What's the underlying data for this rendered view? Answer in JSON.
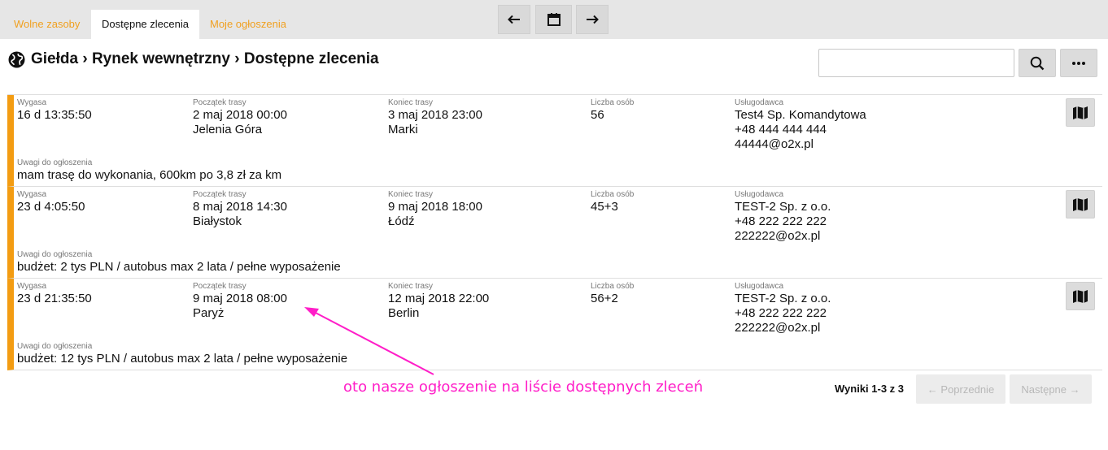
{
  "tabs": [
    {
      "label": "Wolne zasoby",
      "active": false
    },
    {
      "label": "Dostępne zlecenia",
      "active": true
    },
    {
      "label": "Moje ogłoszenia",
      "active": false
    }
  ],
  "nav": {
    "prev_icon": "arrow-left-icon",
    "calendar_icon": "calendar-icon",
    "next_icon": "arrow-right-icon"
  },
  "breadcrumb": {
    "icon": "globe-icon",
    "text": "Giełda › Rynek wewnętrzny › Dostępne zlecenia"
  },
  "search": {
    "value": "",
    "placeholder": "",
    "button_icon": "search-icon",
    "more_icon": "more-icon"
  },
  "labels": {
    "expires": "Wygasa",
    "route_start": "Początek trasy",
    "route_end": "Koniec trasy",
    "persons": "Liczba osób",
    "provider": "Usługodawca",
    "notes": "Uwagi do ogłoszenia"
  },
  "listings": [
    {
      "expires": "16 d 13:35:50",
      "start_date": "2 maj 2018 00:00",
      "start_city": "Jelenia Góra",
      "end_date": "3 maj 2018 23:00",
      "end_city": "Marki",
      "persons": "56",
      "provider_name": "Test4 Sp. Komandytowa",
      "provider_phone": "+48 444 444 444",
      "provider_email": "44444@o2x.pl",
      "notes": "mam trasę do wykonania, 600km po 3,8 zł za km"
    },
    {
      "expires": "23 d 4:05:50",
      "start_date": "8 maj 2018 14:30",
      "start_city": "Białystok",
      "end_date": "9 maj 2018 18:00",
      "end_city": "Łódź",
      "persons": "45+3",
      "provider_name": "TEST-2 Sp. z o.o.",
      "provider_phone": "+48 222 222 222",
      "provider_email": "222222@o2x.pl",
      "notes": "budżet: 2 tys PLN / autobus max 2 lata / pełne wyposażenie"
    },
    {
      "expires": "23 d 21:35:50",
      "start_date": "9 maj 2018 08:00",
      "start_city": "Paryż",
      "end_date": "12 maj 2018 22:00",
      "end_city": "Berlin",
      "persons": "56+2",
      "provider_name": "TEST-2 Sp. z o.o.",
      "provider_phone": "+48 222 222 222",
      "provider_email": "222222@o2x.pl",
      "notes": "budżet: 12 tys PLN / autobus max 2 lata / pełne wyposażenie"
    }
  ],
  "annotation": "oto nasze ogłoszenie na liście dostępnych zleceń",
  "pagination": {
    "results": "Wyniki 1-3 z 3",
    "prev": "← Poprzednie",
    "next": "Następne →"
  },
  "colors": {
    "accent": "#f39c12",
    "tab_inactive": "#f0a020",
    "annotation": "#ff1ec8"
  }
}
